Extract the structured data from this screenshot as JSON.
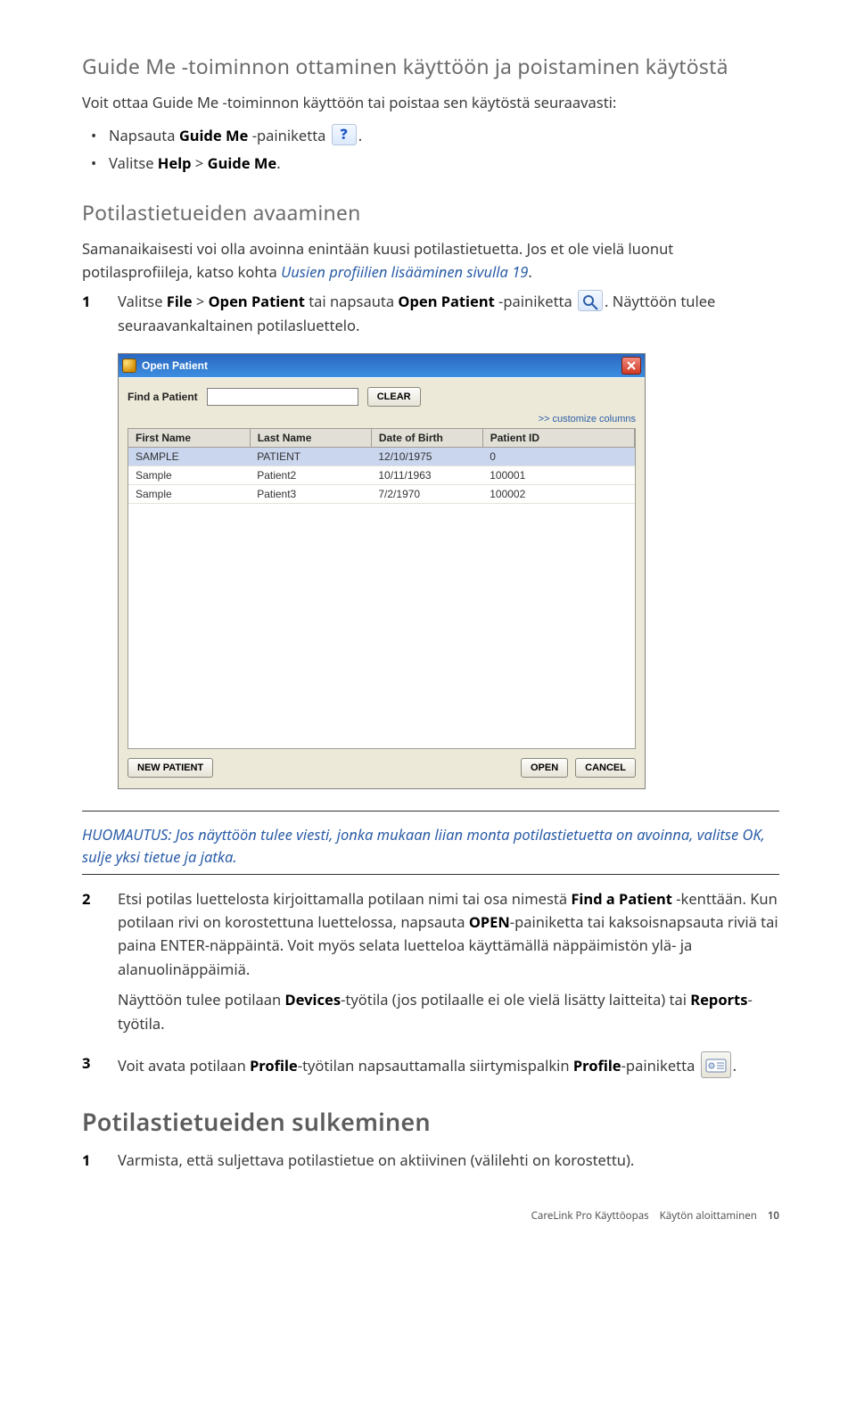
{
  "h1": "Guide Me -toiminnon ottaminen käyttöön ja poistaminen käytöstä",
  "intro": "Voit ottaa Guide Me -toiminnon käyttöön tai poistaa sen käytöstä seuraavasti:",
  "bul1_a": "Napsauta ",
  "bul1_b": "Guide Me",
  "bul1_c": " -painiketta ",
  "bul1_d": ".",
  "bul2_a": "Valitse ",
  "bul2_b": "Help",
  "bul2_c": " > ",
  "bul2_d": "Guide Me",
  "bul2_e": ".",
  "h2": "Potilastietueiden avaaminen",
  "p2a": "Samanaikaisesti voi olla avoinna enintään kuusi potilastietuetta. Jos et ole vielä luonut potilasprofiileja, katso kohta ",
  "p2b": "Uusien profiilien lisääminen sivulla 19",
  "p2c": ".",
  "s1_a": "Valitse ",
  "s1_b": "File",
  "s1_c": " > ",
  "s1_d": "Open Patient",
  "s1_e": " tai napsauta ",
  "s1_f": "Open Patient",
  "s1_g": " -painiketta ",
  "s1_h": ". Näyttöön tulee seuraavankaltainen potilasluettelo.",
  "dialog": {
    "title": "Open Patient",
    "find_label": "Find a Patient",
    "find_value": "",
    "clear": "CLEAR",
    "customize": ">> customize columns",
    "cols": [
      "First Name",
      "Last Name",
      "Date of Birth",
      "Patient ID"
    ],
    "rows": [
      {
        "fn": "SAMPLE",
        "ln": "PATIENT",
        "dob": "12/10/1975",
        "pid": "0",
        "sel": true
      },
      {
        "fn": "Sample",
        "ln": "Patient2",
        "dob": "10/11/1963",
        "pid": "100001",
        "sel": false
      },
      {
        "fn": "Sample",
        "ln": "Patient3",
        "dob": "7/2/1970",
        "pid": "100002",
        "sel": false
      }
    ],
    "new_patient": "NEW PATIENT",
    "open": "OPEN",
    "cancel": "CANCEL"
  },
  "note_a": "HUOMAUTUS: Jos näyttöön tulee viesti, jonka mukaan liian monta potilastietuetta on avoinna, valitse OK, sulje yksi tietue ja jatka.",
  "s2_a": "Etsi potilas luettelosta kirjoittamalla potilaan nimi tai osa nimestä ",
  "s2_b": "Find a Patient",
  "s2_c": " -kenttään. Kun potilaan rivi on korostettuna luettelossa, napsauta ",
  "s2_d": "OPEN",
  "s2_e": "-painiketta tai kaksoisnapsauta riviä tai paina ENTER-näppäintä. Voit myös selata luetteloa käyttämällä näppäimistön ylä- ja alanuolinäppäimiä.",
  "s2_p2a": "Näyttöön tulee potilaan ",
  "s2_p2b": "Devices",
  "s2_p2c": "-työtila (jos potilaalle ei ole vielä lisätty laitteita) tai ",
  "s2_p2d": "Reports",
  "s2_p2e": "-työtila.",
  "s3_a": "Voit avata potilaan ",
  "s3_b": "Profile",
  "s3_c": "-työtilan napsauttamalla siirtymispalkin ",
  "s3_d": "Profile",
  "s3_e": "-painiketta ",
  "s3_f": ".",
  "h3": "Potilastietueiden sulkeminen",
  "close1": "Varmista, että suljettava potilastietue on aktiivinen (välilehti on korostettu).",
  "footer_left": "CareLink Pro Käyttöopas",
  "footer_mid": "Käytön aloittaminen",
  "footer_page": "10"
}
